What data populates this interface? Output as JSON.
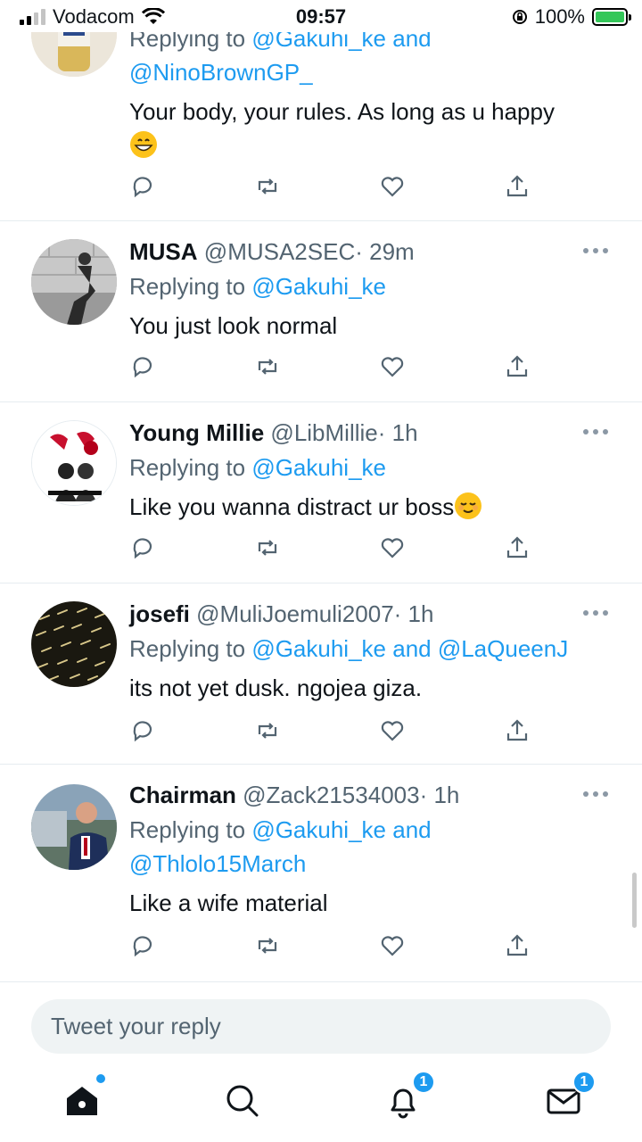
{
  "status_bar": {
    "carrier": "Vodacom",
    "time": "09:57",
    "battery_percent": "100%",
    "icons": [
      "signal-icon",
      "wifi-icon",
      "orientation-lock-icon",
      "battery-charging-icon"
    ]
  },
  "tweets": [
    {
      "name": "",
      "handle": "",
      "time": "",
      "reply_prefix": "Replying to",
      "mentions_line1": "@Gakuhi_ke and",
      "mentions_line2": "@NinoBrownGP_",
      "text": "Your body, your rules. As long as u happy",
      "emoji": "grinning-face-emoji"
    },
    {
      "name": "MUSA",
      "handle": "@MUSA2SEC",
      "time": "· 29m",
      "reply_prefix": "Replying to",
      "mentions_line1": "@Gakuhi_ke",
      "text": "You just look normal"
    },
    {
      "name": "Young Millie",
      "handle": "@LibMillie",
      "time": "· 1h",
      "reply_prefix": "Replying to",
      "mentions_line1": "@Gakuhi_ke",
      "text": "Like you wanna distract ur boss",
      "emoji": "relieved-face-emoji"
    },
    {
      "name": "josefi",
      "handle": "@MuliJoemuli2007",
      "time": "· 1h",
      "reply_prefix": "Replying to",
      "mentions_line1": "@Gakuhi_ke and @LaQueenJ",
      "text": "its not yet dusk. ngojea giza."
    },
    {
      "name": "Chairman",
      "handle": "@Zack21534003",
      "time": "· 1h",
      "reply_prefix": "Replying to",
      "mentions_line1": "@Gakuhi_ke and",
      "mentions_line2": "@Thlolo15March",
      "text": "Like a wife material"
    }
  ],
  "reply_box": {
    "placeholder": "Tweet your reply"
  },
  "bottom_nav": {
    "items": [
      "home-icon",
      "search-icon",
      "notifications-icon",
      "messages-icon"
    ],
    "notifications_badge": "1",
    "messages_badge": "1"
  },
  "colors": {
    "accent": "#1d9bf0",
    "text": "#0f1419",
    "secondary": "#536471",
    "divider": "#e6ecf0"
  }
}
